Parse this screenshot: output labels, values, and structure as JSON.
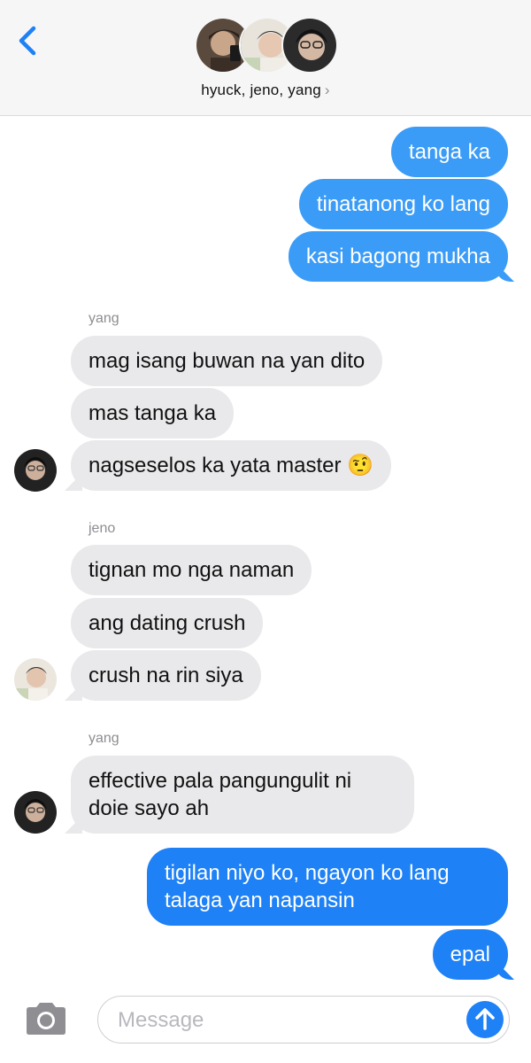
{
  "header": {
    "back_icon": "chevron-left-icon",
    "group_name": "hyuck, jeno, yang",
    "chevron": "›"
  },
  "messages": [
    {
      "id": 0,
      "direction": "outgoing",
      "text": "tanga ka"
    },
    {
      "id": 1,
      "direction": "outgoing",
      "text": "tinatanong ko lang"
    },
    {
      "id": 2,
      "direction": "outgoing",
      "text": "kasi bagong mukha"
    },
    {
      "id": 3,
      "direction": "incoming",
      "sender": "yang",
      "text": "mag isang buwan na yan dito"
    },
    {
      "id": 4,
      "direction": "incoming",
      "sender": "yang",
      "text": "mas tanga ka"
    },
    {
      "id": 5,
      "direction": "incoming",
      "sender": "yang",
      "text": "nagseselos ka yata master 🤨"
    },
    {
      "id": 6,
      "direction": "incoming",
      "sender": "jeno",
      "text": "tignan mo nga naman"
    },
    {
      "id": 7,
      "direction": "incoming",
      "sender": "jeno",
      "text": "ang dating crush"
    },
    {
      "id": 8,
      "direction": "incoming",
      "sender": "jeno",
      "text": "crush na rin siya"
    },
    {
      "id": 9,
      "direction": "incoming",
      "sender": "yang",
      "text_lines": [
        "effective pala pangungulit ni",
        "doie sayo ah"
      ]
    },
    {
      "id": 10,
      "direction": "outgoing",
      "text_lines": [
        "tigilan niyo ko, ngayon ko lang",
        "talaga yan napansin"
      ]
    },
    {
      "id": 11,
      "direction": "outgoing",
      "text": "epal"
    }
  ],
  "senders": {
    "yang_1": "yang",
    "jeno": "jeno",
    "yang_2": "yang"
  },
  "composer": {
    "placeholder": "Message",
    "camera_icon": "camera-icon",
    "send_icon": "arrow-up-icon"
  },
  "colors": {
    "outgoing_bubble": "#3b9cf7",
    "outgoing_bubble_dark": "#1e81f6",
    "incoming_bubble": "#e9e9eb",
    "accent": "#1e81f6"
  }
}
